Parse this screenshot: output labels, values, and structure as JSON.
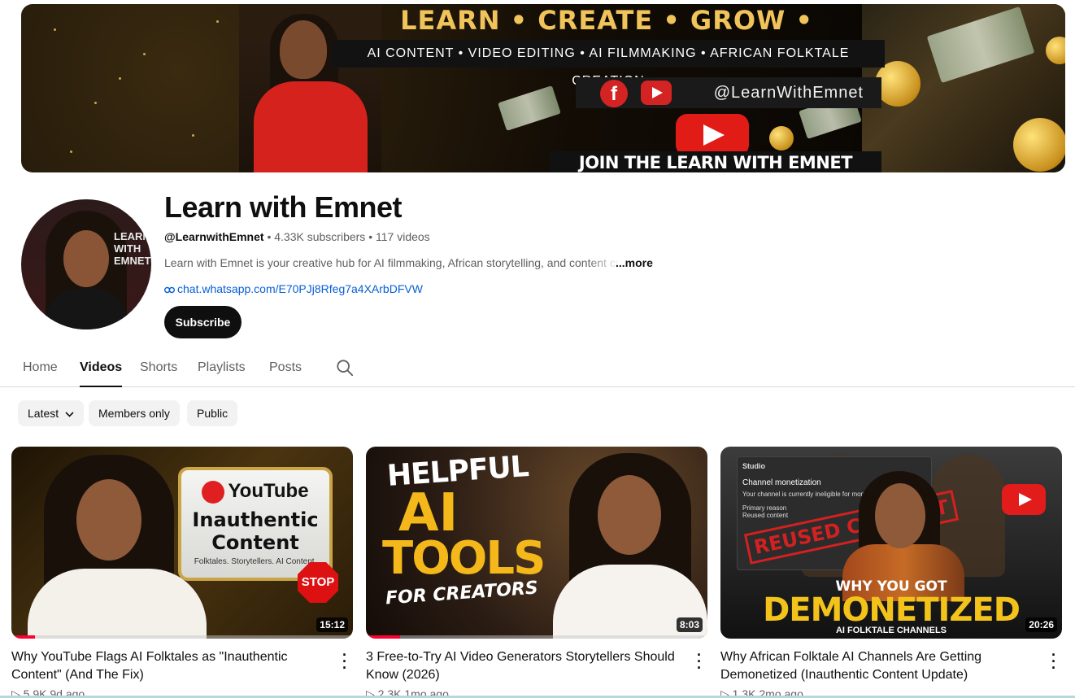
{
  "banner": {
    "headline": "LEARN • CREATE • GROW • MONETIZE",
    "subline": "AI CONTENT • VIDEO EDITING • AI FILMMAKING • AFRICAN FOLKTALE CREATION",
    "handle": "@LearnWithEmnet",
    "cta": "JOIN THE LEARN WITH EMNET COMMUNITY",
    "fb_glyph": "f"
  },
  "avatar_text": "LEARN WITH EMNET",
  "channel": {
    "name": "Learn with Emnet",
    "handle": "@LearnwithEmnet",
    "separator": " • ",
    "subscribers": "4.33K subscribers",
    "videos_count": "117 videos",
    "description": "Learn with Emnet is your creative hub for AI filmmaking, African storytelling, and content creation",
    "more_label": "...more",
    "link_icon": "link-icon",
    "link": "chat.whatsapp.com/E70PJj8Rfeg7a4XArbDFVW",
    "subscribe_label": "Subscribe"
  },
  "tabs": [
    {
      "label": "Home",
      "active": false
    },
    {
      "label": "Videos",
      "active": true
    },
    {
      "label": "Shorts",
      "active": false
    },
    {
      "label": "Playlists",
      "active": false
    },
    {
      "label": "Posts",
      "active": false
    }
  ],
  "filters": {
    "sort_label": "Latest",
    "members_label": "Members only",
    "public_label": "Public"
  },
  "videos": [
    {
      "title": "Why YouTube Flags AI Folktales as \"Inauthentic Content\" (And The Fix)",
      "duration": "15:12",
      "views": "5.9K",
      "age": "9d ago",
      "watched_fraction": 0.07,
      "thumb": {
        "logo": "YouTube",
        "headline": "Inauthentic Content",
        "tagline": "Folktales. Storytellers. AI Content.",
        "stop": "STOP"
      }
    },
    {
      "title": "3 Free-to-Try AI Video Generators Storytellers Should Know (2026)",
      "duration": "8:03",
      "views": "2.3K",
      "age": "1mo ago",
      "watched_fraction": 0.1,
      "thumb": {
        "line1": "HELPFUL",
        "line2": "AI",
        "line3": "TOOLS",
        "line4": "FOR CREATORS"
      }
    },
    {
      "title": "Why African Folktale AI Channels Are Getting Demonetized (Inauthentic Content Update)",
      "duration": "20:26",
      "views": "1.3K",
      "age": "2mo ago",
      "watched_fraction": 0,
      "thumb": {
        "studio": "Studio",
        "panel_title": "Channel monetization",
        "panel_text": "Your channel is currently ineligible for monetization.",
        "reason_label": "Primary reason",
        "reason": "Reused content",
        "stamp": "REUSED CONTENT",
        "top": "WHY YOU GOT",
        "big": "DEMONETIZED",
        "bottom": "AI FOLKTALE CHANNELS"
      }
    }
  ],
  "stats_icon": "▷",
  "colors": {
    "accent": "#ff0033",
    "link": "#065fd4",
    "subscribe_bg": "#0f0f0f",
    "banner_gold": "#f0c45a"
  }
}
